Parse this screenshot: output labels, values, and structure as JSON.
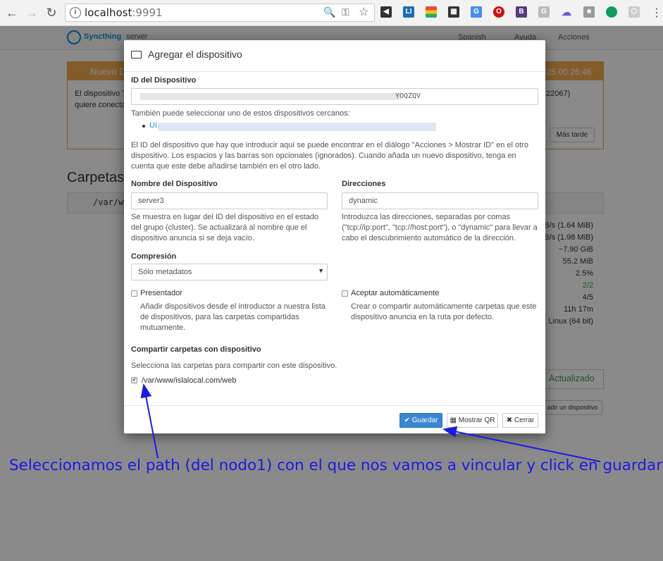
{
  "browser": {
    "url_host": "localhost",
    "url_port": ":9991"
  },
  "app": {
    "brand": "Syncthing",
    "hostname": "server",
    "nav": {
      "language": "Spanish",
      "help": "Ayuda",
      "actions": "Acciones"
    },
    "alert": {
      "title": "Nuevo D",
      "time": "-25 00:26:46",
      "line1": "El dispositivo \"",
      "line2": "quiere conecta",
      "addr": ":22067)",
      "later_button": "Más tarde"
    },
    "folders_heading": "Carpetas",
    "folder_path": "/var/ww",
    "stats": [
      "B/s (1.64 MiB)",
      "B/s (1.98 MiB)",
      "~7.90 GiB",
      "55.2 MiB",
      "2.5%",
      "2/2",
      "4/5",
      "11h 17m",
      ", Linux (64 bit)"
    ],
    "status_updated": "Actualizado",
    "add_device_button": "adir un dispositivo"
  },
  "modal": {
    "title": "Agregar el dispositivo",
    "device_id_label": "ID del Dispositivo",
    "device_id_value_visible": "YOQZQV",
    "nearby_text": "También puede seleccionar uno de estos dispositivos cercanos:",
    "nearby_item_prefix": "UI",
    "id_help": "El ID del dispositivo que hay que introducir aquí se puede encontrar en el diálogo \"Acciones > Mostrar ID\" en el otro dispositivo. Los espacios y las barras son opcionales (ignorados). Cuando añada un nuevo dispositivo, tenga en cuenta que este debe añadirse también en el otro lado.",
    "name_label": "Nombre del Dispositivo",
    "name_value": "server3",
    "name_help": "Se muestra en lugar del ID del dispositivo en el estado del grupo (cluster). Se actualizará al nombre que el dispositivo anuncia si se deja vacío.",
    "addresses_label": "Direcciones",
    "addresses_value": "dynamic",
    "addresses_help": "Introduzca las direcciones, separadas por comas (\"tcp://ip:port\", \"tcp://host:port\"), o \"dynamic\" para llevar a cabo el descubrimiento automático de la dirección.",
    "compression_label": "Compresión",
    "compression_value": "Sólo metadatos",
    "introducer_label": "Presentador",
    "introducer_help": "Añadir dispositivos desde el introductor a nuestra lista de dispositivos, para las carpetas compartidas mutuamente.",
    "autoaccept_label": "Aceptar automáticamente",
    "autoaccept_help": "Crear o compartir automáticamente carpetas que este dispositivo anuncia en la ruta por defecto.",
    "share_label": "Compartir carpetas con dispositivo",
    "share_help": "Selecciona las carpetas para compartir con este dispositivo.",
    "share_folder": "/var/www/islalocal.com/web",
    "save_button": "Guardar",
    "qr_button": "Mostrar QR",
    "close_button": "Cerrar"
  },
  "annotation": "Seleccionamos el path (del nodo1) con el que nos vamos a vincular y click en guardar"
}
